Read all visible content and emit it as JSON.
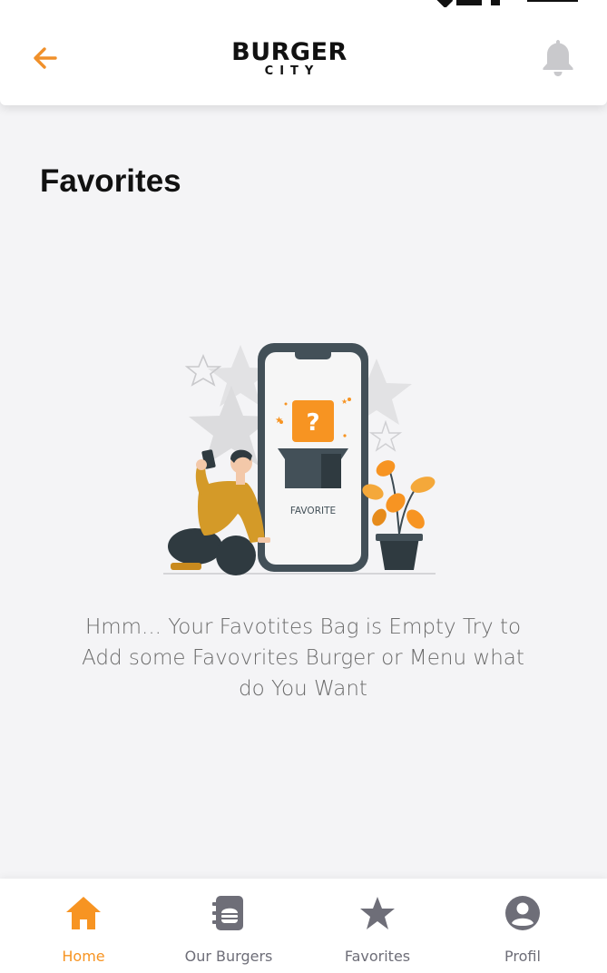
{
  "header": {
    "logo_main": "BURGER",
    "logo_sub": "CITY",
    "back_icon": "arrow-left-icon",
    "bell_icon": "bell-icon"
  },
  "page": {
    "title": "Favorites"
  },
  "illustration": {
    "box_label": "FAVORITE",
    "question_mark": "?"
  },
  "empty_state": {
    "message": "Hmm... Your Favotites Bag is Empty Try to Add some Favovrites Burger or Menu what do You Want"
  },
  "bottom_nav": {
    "items": [
      {
        "label": "Home",
        "icon": "home-icon",
        "active": true
      },
      {
        "label": "Our Burgers",
        "icon": "menu-book-icon",
        "active": false
      },
      {
        "label": "Favorites",
        "icon": "star-icon",
        "active": false
      },
      {
        "label": "Profil",
        "icon": "profile-icon",
        "active": false
      }
    ]
  },
  "colors": {
    "accent": "#f79422",
    "inactive": "#6e6e78",
    "background": "#f4f4f6",
    "phone_dark": "#435058"
  }
}
